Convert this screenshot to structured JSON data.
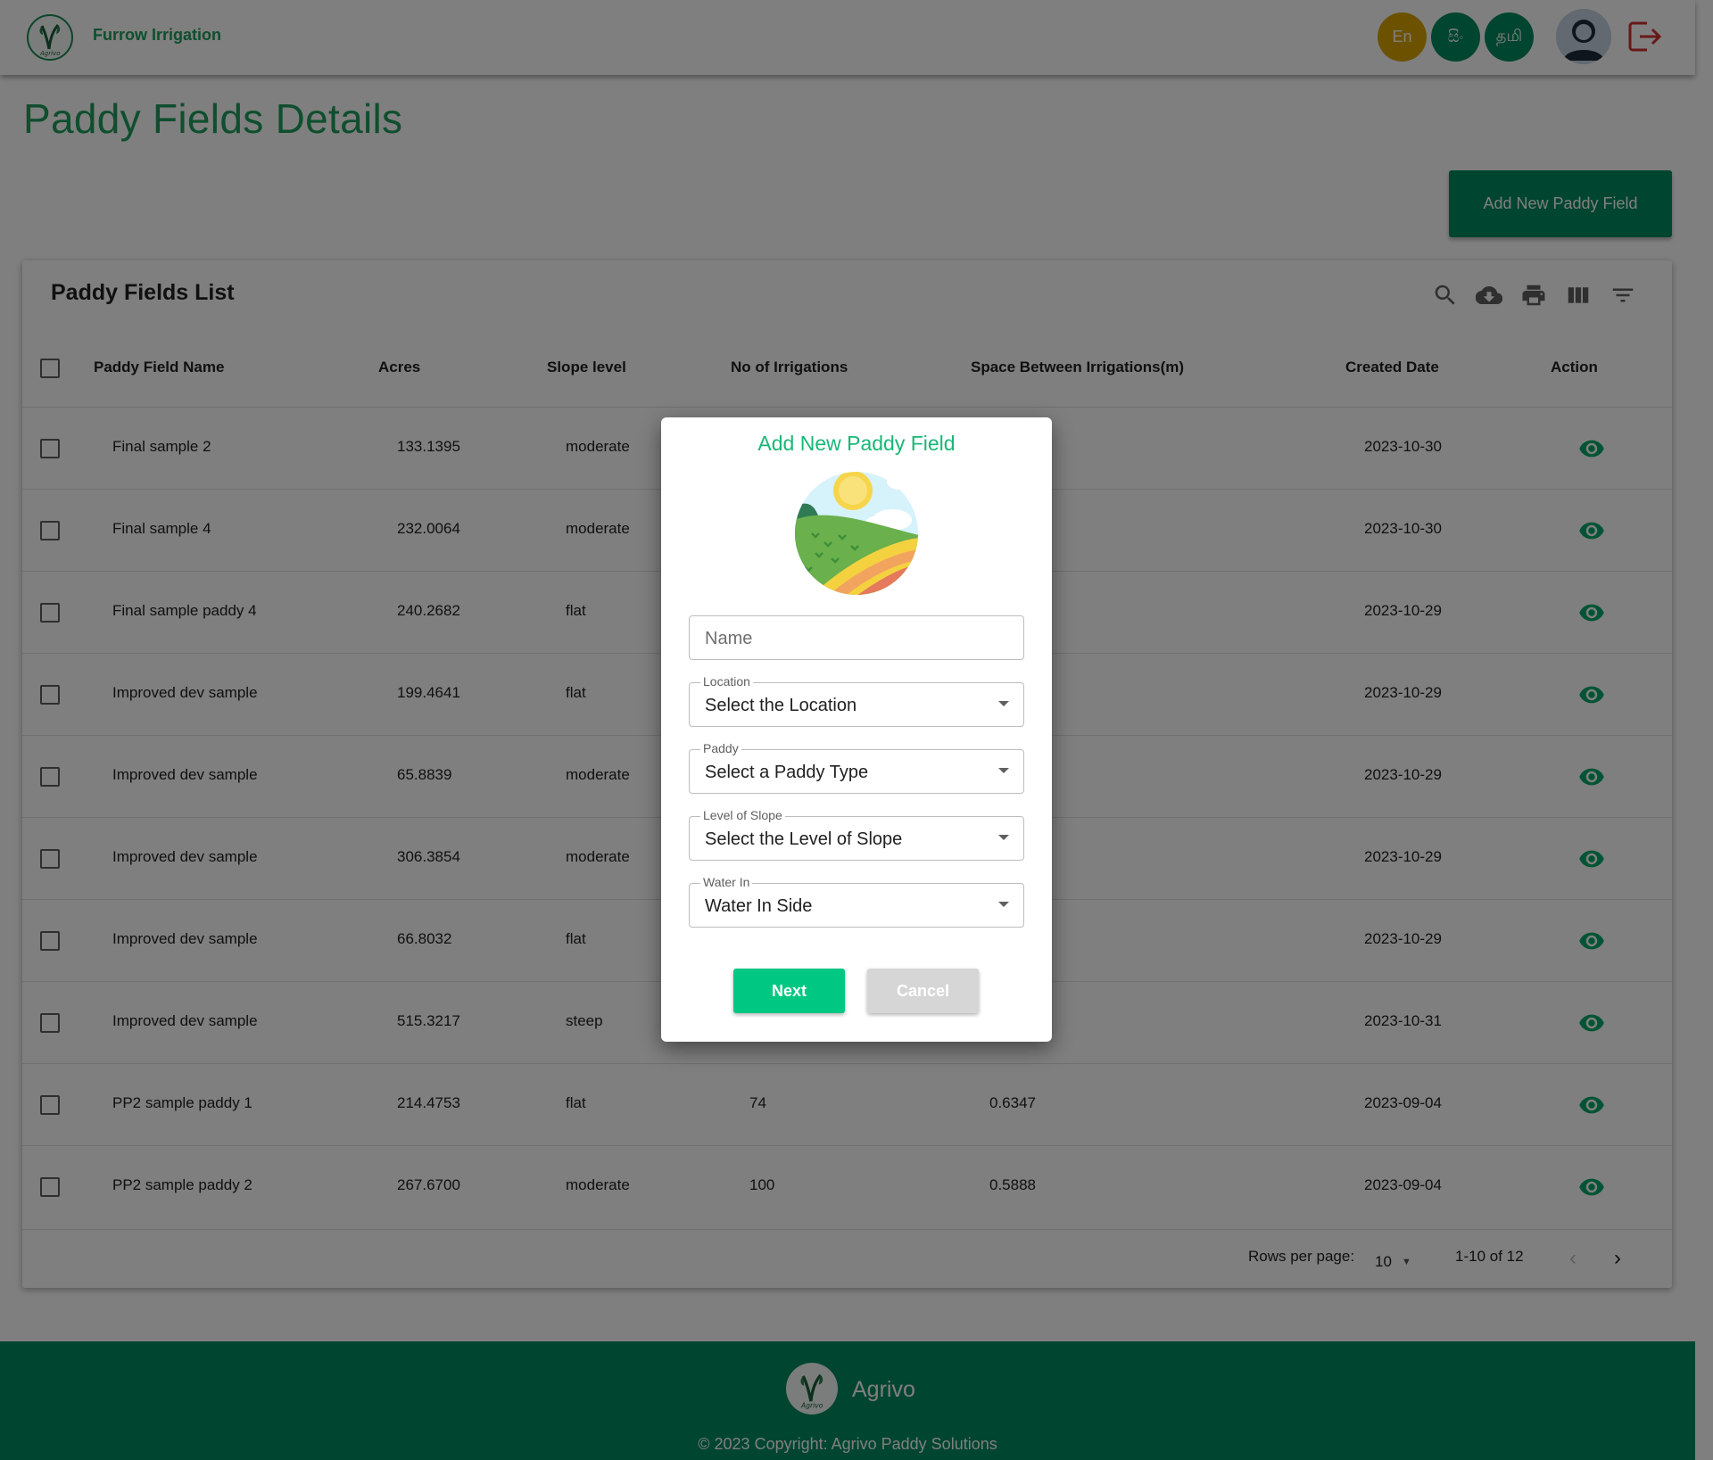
{
  "header": {
    "app_title": "Furrow Irrigation",
    "logo_text": "Agrivo",
    "languages": [
      "En",
      "සිං",
      "தமி"
    ]
  },
  "page": {
    "title": "Paddy Fields Details",
    "add_button": "Add New Paddy Field"
  },
  "table": {
    "title": "Paddy Fields List",
    "toolbar_icons": [
      "search-icon",
      "cloud-download-icon",
      "print-icon",
      "view-columns-icon",
      "filter-icon"
    ],
    "columns": [
      "Paddy Field Name",
      "Acres",
      "Slope level",
      "No of Irrigations",
      "Space Between Irrigations(m)",
      "Created Date",
      "Action"
    ],
    "rows": [
      {
        "name": "Final sample 2",
        "acres": "133.1395",
        "slope": "moderate",
        "irrigations": "",
        "space": "",
        "created": "2023-10-30"
      },
      {
        "name": "Final sample 4",
        "acres": "232.0064",
        "slope": "moderate",
        "irrigations": "",
        "space": "",
        "created": "2023-10-30"
      },
      {
        "name": "Final sample paddy 4",
        "acres": "240.2682",
        "slope": "flat",
        "irrigations": "",
        "space": "",
        "created": "2023-10-29"
      },
      {
        "name": "Improved dev sample",
        "acres": "199.4641",
        "slope": "flat",
        "irrigations": "",
        "space": "",
        "created": "2023-10-29"
      },
      {
        "name": "Improved dev sample",
        "acres": "65.8839",
        "slope": "moderate",
        "irrigations": "",
        "space": "",
        "created": "2023-10-29"
      },
      {
        "name": "Improved dev sample",
        "acres": "306.3854",
        "slope": "moderate",
        "irrigations": "",
        "space": "",
        "created": "2023-10-29"
      },
      {
        "name": "Improved dev sample",
        "acres": "66.8032",
        "slope": "flat",
        "irrigations": "",
        "space": "",
        "created": "2023-10-29"
      },
      {
        "name": "Improved dev sample",
        "acres": "515.3217",
        "slope": "steep",
        "irrigations": "",
        "space": "",
        "created": "2023-10-31"
      },
      {
        "name": "PP2 sample paddy 1",
        "acres": "214.4753",
        "slope": "flat",
        "irrigations": "74",
        "space": "0.6347",
        "created": "2023-09-04"
      },
      {
        "name": "PP2 sample paddy 2",
        "acres": "267.6700",
        "slope": "moderate",
        "irrigations": "100",
        "space": "0.5888",
        "created": "2023-09-04"
      }
    ],
    "pagination": {
      "rows_per_page_label": "Rows per page:",
      "rows_per_page": "10",
      "range": "1-10 of 12"
    }
  },
  "footer": {
    "brand": "Agrivo",
    "copyright": "© 2023 Copyright: Agrivo Paddy Solutions"
  },
  "modal": {
    "title": "Add New Paddy Field",
    "name_placeholder": "Name",
    "location": {
      "label": "Location",
      "value": "Select the Location"
    },
    "paddy": {
      "label": "Paddy",
      "value": "Select a Paddy Type"
    },
    "slope": {
      "label": "Level of Slope",
      "value": "Select the Level of Slope"
    },
    "water": {
      "label": "Water In",
      "value": "Water In Side"
    },
    "next_button": "Next",
    "cancel_button": "Cancel"
  },
  "colors": {
    "primary": "#008a5e",
    "accent_green": "#1f9d5c",
    "modal_accent": "#17b877",
    "lang_en": "#d9a400",
    "logout": "#d32f2f"
  }
}
